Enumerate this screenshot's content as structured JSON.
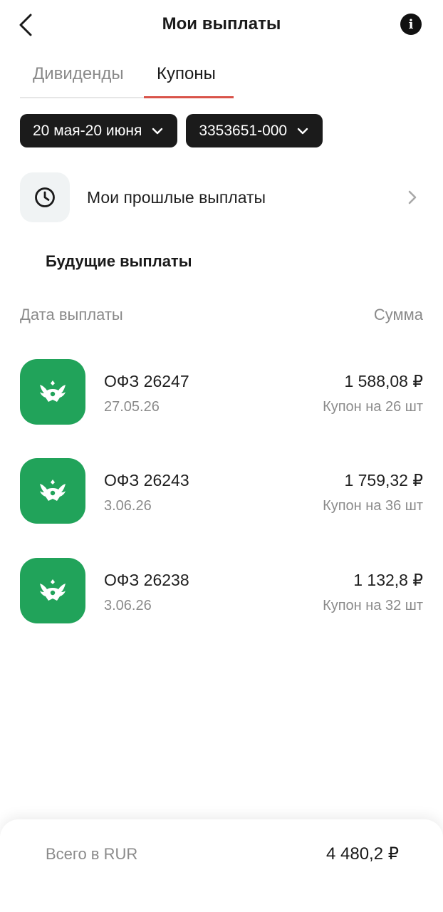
{
  "header": {
    "title": "Мои выплаты",
    "info_glyph": "i"
  },
  "tabs": [
    {
      "label": "Дивиденды",
      "active": false
    },
    {
      "label": "Купоны",
      "active": true
    }
  ],
  "filters": {
    "period": "20 мая-20 июня",
    "account": "3353651-000"
  },
  "past_payouts": {
    "label": "Мои прошлые выплаты",
    "icon": "clock-icon"
  },
  "section_title": "Будущие выплаты",
  "columns": {
    "left": "Дата выплаты",
    "right": "Сумма"
  },
  "payments": [
    {
      "name": "ОФЗ 26247",
      "date": "27.05.26",
      "amount": "1 588,08 ₽",
      "qty": "Купон на 26 шт"
    },
    {
      "name": "ОФЗ 26243",
      "date": "3.06.26",
      "amount": "1 759,32 ₽",
      "qty": "Купон на 36 шт"
    },
    {
      "name": "ОФЗ 26238",
      "date": "3.06.26",
      "amount": "1 132,8 ₽",
      "qty": "Купон на 32 шт"
    }
  ],
  "total": {
    "label": "Всего в RUR",
    "value": "4 480,2 ₽"
  },
  "colors": {
    "accent_red": "#d9534a",
    "bond_green": "#21a35a",
    "chip_bg": "#1b1b1b",
    "muted_text": "#8a8a8a"
  }
}
